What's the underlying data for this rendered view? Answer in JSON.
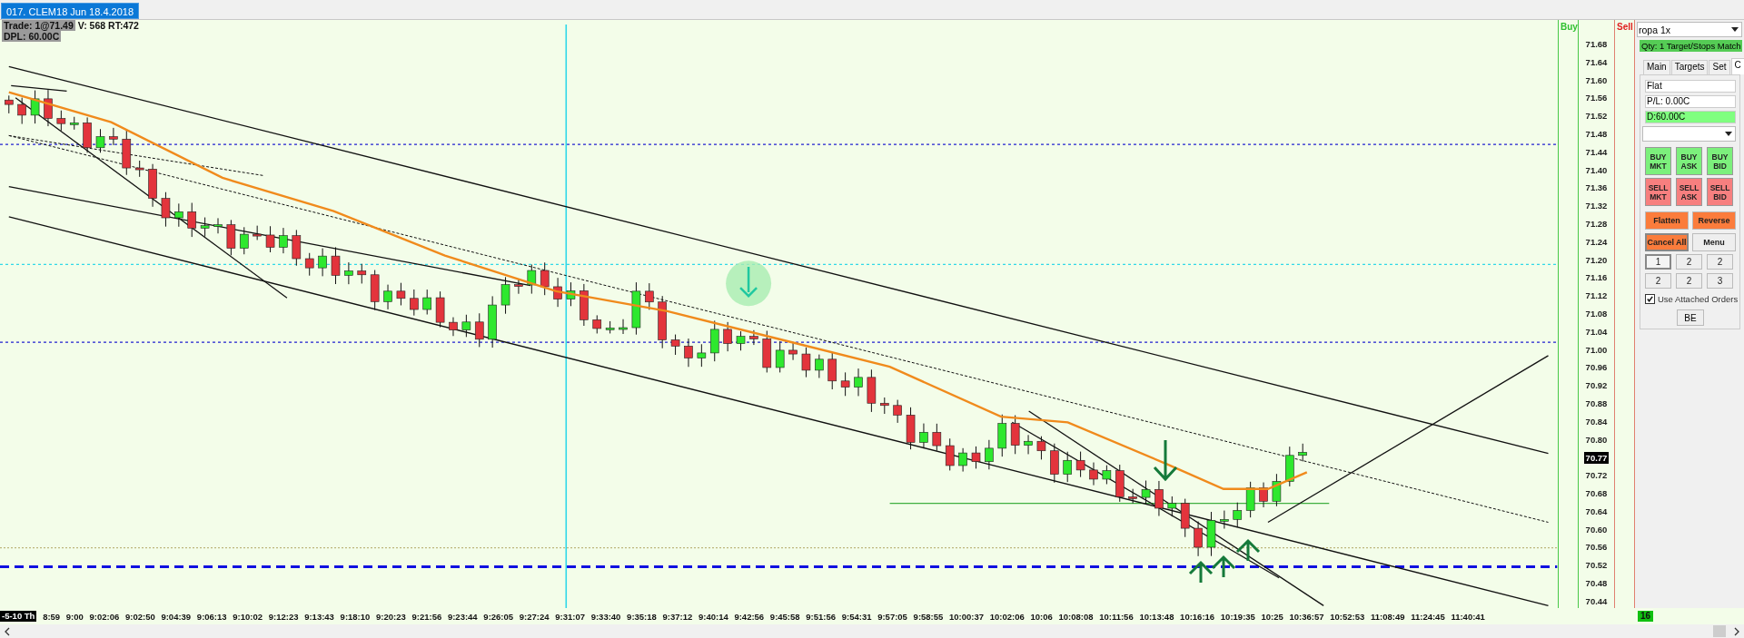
{
  "tab": {
    "title": "017. CLEM18 Jun 18.4.2018",
    "selected": true
  },
  "chart_header": {
    "trade": "Trade: 1@71.49",
    "volume": "V: 568 RT:472",
    "dpl": "DPL: 60.00C"
  },
  "price_ladder": {
    "buy_label": "Buy",
    "sell_label": "Sell",
    "current_price": "70.77",
    "prices": [
      "71.68",
      "71.64",
      "71.60",
      "71.56",
      "71.52",
      "71.48",
      "71.44",
      "71.40",
      "71.36",
      "71.32",
      "71.28",
      "71.24",
      "71.20",
      "71.16",
      "71.12",
      "71.08",
      "71.04",
      "71.00",
      "70.96",
      "70.92",
      "70.88",
      "70.84",
      "70.80",
      "70.72",
      "70.68",
      "70.64",
      "70.60",
      "70.56",
      "70.52",
      "70.48",
      "70.44"
    ]
  },
  "time_axis": {
    "session": "-5-10 Th",
    "labels": [
      "8:59",
      "9:00",
      "9:02:06",
      "9:02:50",
      "9:04:39",
      "9:06:13",
      "9:10:02",
      "9:12:23",
      "9:13:43",
      "9:18:10",
      "9:20:23",
      "9:21:56",
      "9:23:44",
      "9:26:05",
      "9:27:24",
      "9:31:07",
      "9:33:40",
      "9:35:18",
      "9:37:12",
      "9:40:14",
      "9:42:56",
      "9:45:58",
      "9:51:56",
      "9:54:31",
      "9:57:05",
      "9:58:55",
      "10:00:37",
      "10:02:06",
      "10:06",
      "10:08:08",
      "10:11:56",
      "10:13:48",
      "10:16:16",
      "10:19:35",
      "10:25",
      "10:36:57",
      "10:52:53",
      "11:08:49",
      "11:24:45",
      "11:40:41"
    ]
  },
  "order_panel": {
    "account": "ropa 1x",
    "status": "Qty: 1 Target/Stops Match",
    "tabs": [
      {
        "label": "Main",
        "selected": false
      },
      {
        "label": "Targets",
        "selected": false
      },
      {
        "label": "Set",
        "selected": false
      },
      {
        "label": "C",
        "selected": true
      }
    ],
    "position": "Flat",
    "pnl": "P/L: 0.00C",
    "daily": "D:60.00C",
    "order_buttons": [
      {
        "label": "BUY MKT",
        "kind": "buy"
      },
      {
        "label": "BUY ASK",
        "kind": "buy"
      },
      {
        "label": "BUY BID",
        "kind": "buy"
      },
      {
        "label": "SELL MKT",
        "kind": "sell"
      },
      {
        "label": "SELL ASK",
        "kind": "sell"
      },
      {
        "label": "SELL BID",
        "kind": "sell"
      }
    ],
    "action_buttons": [
      {
        "label": "Flatten",
        "kind": "action"
      },
      {
        "label": "Reverse",
        "kind": "action"
      },
      {
        "label": "Cancel All",
        "kind": "pressed"
      },
      {
        "label": "Menu",
        "kind": "plain"
      }
    ],
    "quantity_buttons": [
      {
        "label": "1",
        "selected": true
      },
      {
        "label": "2",
        "selected": false
      },
      {
        "label": "2",
        "selected": false
      },
      {
        "label": "2",
        "selected": false
      },
      {
        "label": "2",
        "selected": false
      },
      {
        "label": "3",
        "selected": false
      }
    ],
    "attached_orders": {
      "label": "Use Attached Orders",
      "checked": true
    },
    "be_button": "BE"
  },
  "bar_count": "16"
}
